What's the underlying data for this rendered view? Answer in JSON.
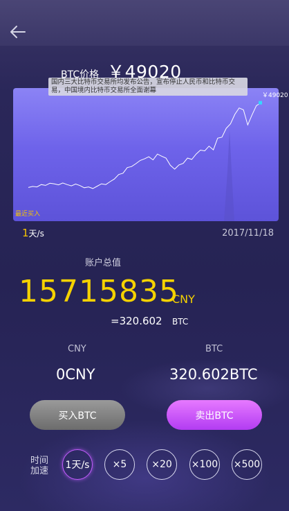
{
  "price": {
    "label": "BTC价格",
    "value": "￥49020"
  },
  "chart_news": "国内三大比特币交易所均发布公告，宣布停止人民币和比特币交易，中国境内比特币交易所全面谢幕",
  "chart_data": {
    "type": "line",
    "title": "",
    "current_value_label": "￥49020",
    "marker_label": "最近买入",
    "series": [
      {
        "values": [
          17200,
          17600,
          17400,
          18300,
          18000,
          18800,
          18600,
          18200,
          18900,
          18300,
          17800,
          18500,
          17900,
          17100,
          17400,
          16800,
          17700,
          18600,
          18300,
          19400,
          20400,
          22100,
          22600,
          24700,
          25100,
          26200,
          27400,
          28000,
          28800,
          27600,
          29800,
          29000,
          28300,
          25600,
          24100,
          25700,
          26300,
          28300,
          27800,
          29800,
          31300,
          31000,
          32800,
          31400,
          35800,
          36200,
          39500,
          41200,
          44800,
          47200,
          46500,
          40800,
          44600,
          48100,
          49020
        ]
      }
    ]
  },
  "speed_current": {
    "num": "1",
    "unit": "天/s"
  },
  "date": "2017/11/18",
  "account": {
    "total_label": "账户总值",
    "total_value": "15715835",
    "total_unit": "CNY",
    "btc_equivalent": "=320.602",
    "btc_equivalent_unit": "BTC"
  },
  "balances": {
    "cny_label": "CNY",
    "cny_value": "0CNY",
    "btc_label": "BTC",
    "btc_value": "320.602BTC"
  },
  "buttons": {
    "buy": "买入BTC",
    "sell": "卖出BTC"
  },
  "speed": {
    "title_line1": "时间",
    "title_line2": "加速",
    "options": [
      "1天/s",
      "×5",
      "×20",
      "×100",
      "×500"
    ],
    "active_index": 0
  },
  "colors": {
    "accent_yellow": "#f5d200",
    "sell_purple": "#c35cff"
  }
}
